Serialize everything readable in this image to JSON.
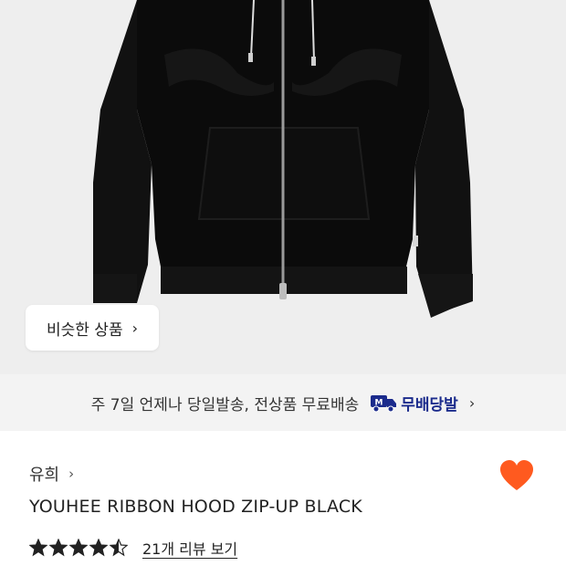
{
  "similar_button": {
    "label": "비슷한 상품",
    "chevron_icon": "chevron-right-icon"
  },
  "shipping_banner": {
    "text": "주 7일 언제나 당일발송, 전상품 무료배송",
    "badge_icon": "truck-m-icon",
    "badge_label": "무배당발",
    "chevron_icon": "chevron-right-icon"
  },
  "product": {
    "brand": "유희",
    "title": "YOUHEE RIBBON HOOD ZIP-UP BLACK",
    "rating": 4.5,
    "reviews_label": "21개 리뷰 보기",
    "wishlisted": true
  },
  "colors": {
    "hero_bg": "#eeeeee",
    "shipbar_bg": "#f3f3f3",
    "badge": "#1b2b8c",
    "heart": "#ff5a1f",
    "star": "#222222"
  }
}
